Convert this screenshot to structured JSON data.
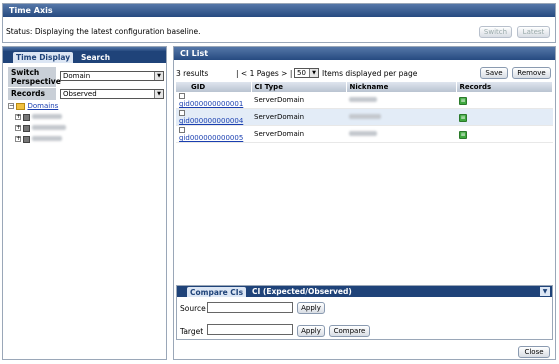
{
  "time_axis": {
    "title": "Time Axis",
    "status_label": "Status:",
    "status_text": "Displaying the latest configuration baseline.",
    "switch_btn": "Switch",
    "latest_btn": "Latest"
  },
  "left": {
    "tabs": [
      "Time Display",
      "Search"
    ],
    "switch_label": "Switch Perspective",
    "switch_value": "Domain",
    "records_label": "Records",
    "records_value": "Observed",
    "tree_root": "Domains"
  },
  "ci_list": {
    "title": "CI List",
    "results": "3 results",
    "pager": "| < 1 Pages > |",
    "per_page": "50",
    "per_page_text": "Items displayed per page",
    "save_btn": "Save",
    "remove_btn": "Remove",
    "columns": [
      "GID",
      "CI Type",
      "Nickname",
      "Records"
    ],
    "rows": [
      {
        "gid": "gid000000000001",
        "type": "ServerDomain"
      },
      {
        "gid": "gid000000000004",
        "type": "ServerDomain"
      },
      {
        "gid": "gid000000000005",
        "type": "ServerDomain"
      }
    ]
  },
  "compare": {
    "tabs": [
      "Compare CIs",
      "CI (Expected/Observed)"
    ],
    "source_label": "Source",
    "target_label": "Target",
    "apply_btn": "Apply",
    "compare_btn": "Compare"
  },
  "close_btn": "Close",
  "colors": {
    "header": "#264a80",
    "tab_bar": "#1f4379",
    "row_alt": "#e3ecf7",
    "records_icon": "#3fa83f"
  }
}
